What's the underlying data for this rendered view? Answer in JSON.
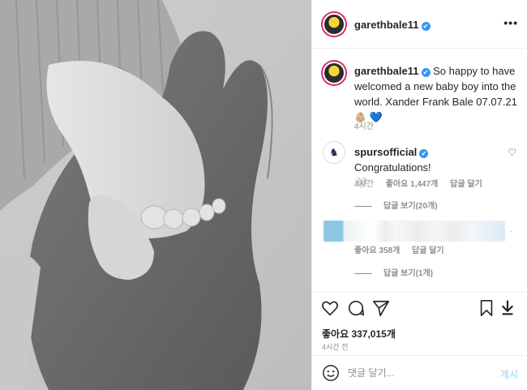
{
  "post": {
    "username": "garethbale11",
    "verified": "✔"
  },
  "caption": {
    "username": "garethbale11",
    "text": "So happy to have welcomed a new baby boy into the world. Xander Frank Bale 07.07.21",
    "baby_emoji": "👶🏼",
    "heart_emoji": "💙",
    "time": "4시간"
  },
  "comments": [
    {
      "username": "spursofficial",
      "text": "Congratulations!",
      "extra_emoji": "🤍",
      "time": "4시간",
      "likes": "좋아요 1,447개",
      "reply_label": "답글 달기",
      "view_replies": "답글 보기(20개)"
    },
    {
      "likes": "좋아요 358개",
      "reply_label": "답글 달기",
      "view_replies": "답글 보기(1개)"
    }
  ],
  "actions": {
    "likes_text": "좋아요 337,015개",
    "post_time": "4시간 전"
  },
  "comment_box": {
    "placeholder": "댓글 달기...",
    "post_label": "게시"
  },
  "icons": {
    "more": "more-options-icon",
    "like": "heart-icon",
    "comment": "comment-icon",
    "share": "share-icon",
    "save": "bookmark-icon",
    "download": "download-icon",
    "emoji": "emoji-icon"
  },
  "colors": {
    "verified": "#3897f0",
    "post_button": "#b2dffc",
    "muted": "#8e8e8e"
  }
}
